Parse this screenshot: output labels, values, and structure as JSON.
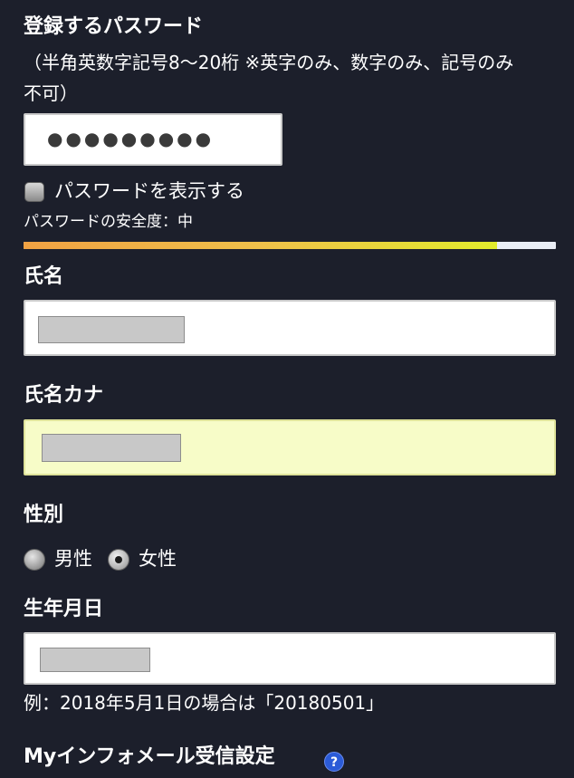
{
  "password_section": {
    "title": "登録するパスワード",
    "rule_line1": "（半角英数字記号8〜20桁 ※英字のみ、数字のみ、記号のみ",
    "rule_line2": "不可）",
    "masked_value": "●●●●●●●●●",
    "show_password_label": "パスワードを表示する",
    "strength_label": "パスワードの安全度：中",
    "strength_level": 0.89
  },
  "name_section": {
    "title": "氏名"
  },
  "kana_section": {
    "title": "氏名カナ"
  },
  "gender_section": {
    "title": "性別",
    "options": [
      "男性",
      "女性"
    ],
    "selected": "女性"
  },
  "birthday_section": {
    "title": "生年月日",
    "example": "例：2018年5月1日の場合は「20180501」"
  },
  "mail_section": {
    "title": "Myインフォメール受信設定",
    "help_icon_text": "?"
  },
  "colors": {
    "background": "#1c1f2b",
    "kana_input_bg": "#f7fcc8",
    "help_icon": "#2b5bd7"
  }
}
